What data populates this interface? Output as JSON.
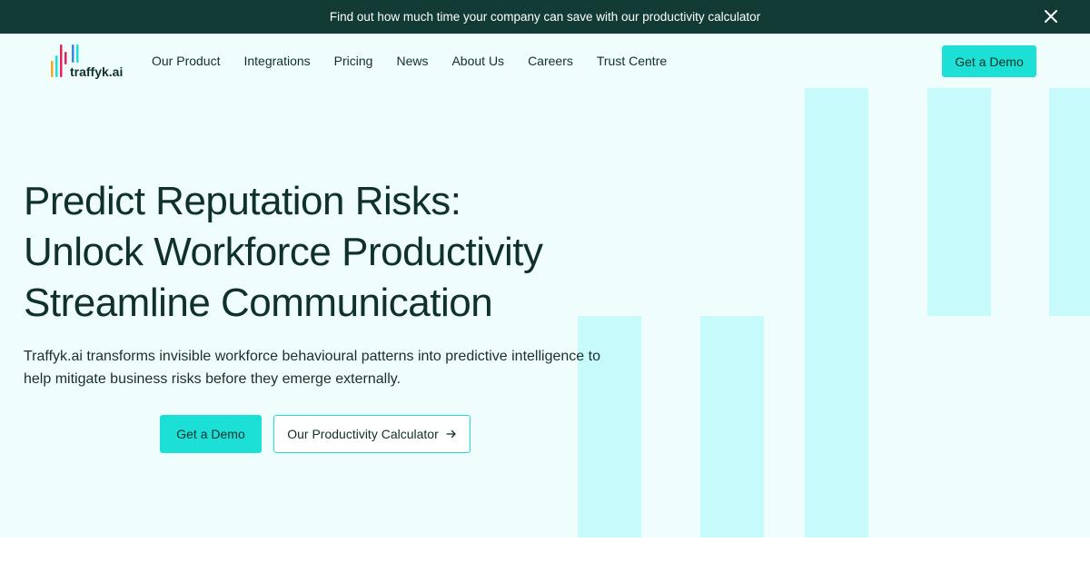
{
  "announcement": {
    "text": "Find out how much time your company can save with our productivity calculator",
    "close_icon": "close-icon"
  },
  "brand": {
    "name": "traffyk.ai",
    "logo_colors": [
      "#f5a623",
      "#1ce0d6",
      "#e0245e",
      "#3b82f6",
      "#7ed957"
    ]
  },
  "nav": {
    "items": [
      {
        "label": "Our Product"
      },
      {
        "label": "Integrations"
      },
      {
        "label": "Pricing"
      },
      {
        "label": "News"
      },
      {
        "label": "About Us"
      },
      {
        "label": "Careers"
      },
      {
        "label": "Trust Centre"
      }
    ],
    "cta_label": "Get a Demo"
  },
  "hero": {
    "headline_lines": [
      "Predict Reputation Risks:",
      "Unlock Workforce Productivity",
      "Streamline Communication"
    ],
    "subtext": "Traffyk.ai transforms invisible workforce behavioural patterns into predictive intelligence to help mitigate business risks before they emerge externally.",
    "primary_cta": "Get a Demo",
    "secondary_cta": "Our Productivity Calculator",
    "secondary_icon": "arrow-right-icon"
  },
  "colors": {
    "announcement_bg": "#123b35",
    "hero_bg": "#effdfd",
    "accent": "#1ce0d6",
    "decor_bars": "#c6fafb",
    "text": "#10302b"
  }
}
